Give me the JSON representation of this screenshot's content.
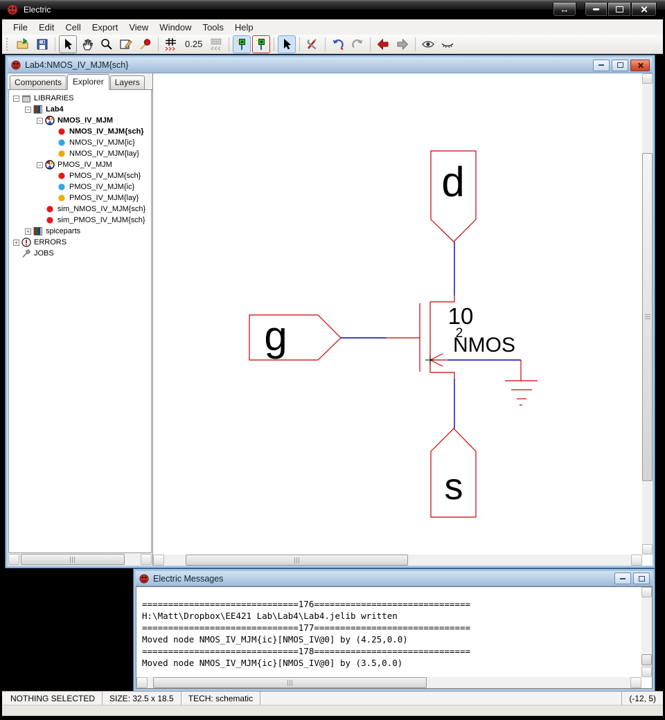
{
  "titlebar": {
    "title": "Electric"
  },
  "menubar": {
    "items": [
      "File",
      "Edit",
      "Cell",
      "Export",
      "View",
      "Window",
      "Tools",
      "Help"
    ]
  },
  "toolbar": {
    "grid_spacing": "0.25",
    "icons": [
      "open-icon",
      "save-icon",
      "|",
      "select-arrow-icon",
      "pan-hand-icon",
      "zoom-icon",
      "edit-cell-icon",
      "probe-icon",
      "|",
      "grid-coarse-icon",
      "grid-value",
      "grid-fine-icon",
      "|",
      "pin-toggle-on-icon",
      "pin-toggle-alt-icon",
      "|",
      "special-select-icon",
      "|",
      "tools-icon",
      "|",
      "undo-icon",
      "redo-icon",
      "|",
      "back-icon",
      "forward-icon",
      "|",
      "eye-open-icon",
      "eye-closed-icon"
    ]
  },
  "schematic_window": {
    "title": "Lab4:NMOS_IV_MJM{sch}",
    "tabs": [
      {
        "label": "Components",
        "active": false
      },
      {
        "label": "Explorer",
        "active": true
      },
      {
        "label": "Layers",
        "active": false
      }
    ],
    "tree": [
      {
        "label": "LIBRARIES",
        "level": 0,
        "icon": "libraries-icon",
        "expand": "minus",
        "bold": false
      },
      {
        "label": "Lab4",
        "level": 1,
        "icon": "library-icon",
        "expand": "minus",
        "bold": true
      },
      {
        "label": "NMOS_IV_MJM",
        "level": 2,
        "icon": "cell-group-icon",
        "expand": "minus",
        "bold": true
      },
      {
        "label": "NMOS_IV_MJM{sch}",
        "level": 3,
        "icon": "schematic-view-icon",
        "expand": "none",
        "bold": true
      },
      {
        "label": "NMOS_IV_MJM{ic}",
        "level": 3,
        "icon": "icon-view-icon",
        "expand": "none",
        "bold": false
      },
      {
        "label": "NMOS_IV_MJM{lay}",
        "level": 3,
        "icon": "layout-view-icon",
        "expand": "none",
        "bold": false
      },
      {
        "label": "PMOS_IV_MJM",
        "level": 2,
        "icon": "cell-group-icon",
        "expand": "minus",
        "bold": false
      },
      {
        "label": "PMOS_IV_MJM{sch}",
        "level": 3,
        "icon": "schematic-view-icon",
        "expand": "none",
        "bold": false
      },
      {
        "label": "PMOS_IV_MJM{ic}",
        "level": 3,
        "icon": "icon-view-icon",
        "expand": "none",
        "bold": false
      },
      {
        "label": "PMOS_IV_MJM{lay}",
        "level": 3,
        "icon": "layout-view-icon",
        "expand": "none",
        "bold": false
      },
      {
        "label": "sim_NMOS_IV_MJM{sch}",
        "level": 2,
        "icon": "schematic-view-icon",
        "expand": "none",
        "bold": false
      },
      {
        "label": "sim_PMOS_IV_MJM{sch}",
        "level": 2,
        "icon": "schematic-view-icon",
        "expand": "none",
        "bold": false
      },
      {
        "label": "spiceparts",
        "level": 1,
        "icon": "library-icon",
        "expand": "plus",
        "bold": false
      },
      {
        "label": "ERRORS",
        "level": 0,
        "icon": "errors-icon",
        "expand": "plus",
        "bold": false
      },
      {
        "label": "JOBS",
        "level": 0,
        "icon": "jobs-icon",
        "expand": "none",
        "bold": false
      }
    ]
  },
  "canvas": {
    "pin_labels": {
      "drain": "d",
      "gate": "g",
      "source": "s"
    },
    "transistor": {
      "width": "10",
      "length": "2",
      "model": "NMOS"
    },
    "colors": {
      "artwork": "#c80000",
      "wire": "#0000bb",
      "text": "#000000"
    }
  },
  "messages_window": {
    "title": "Electric Messages",
    "lines": [
      "==============================176==============================",
      "H:\\Matt\\Dropbox\\EE421 Lab\\Lab4\\Lab4.jelib written",
      "==============================177==============================",
      "Moved node NMOS_IV_MJM{ic}[NMOS_IV@0] by (4.25,0.0)",
      "==============================178==============================",
      "Moved node NMOS_IV_MJM{ic}[NMOS_IV@0] by (3.5,0.0)"
    ]
  },
  "statusbar": {
    "selection": "NOTHING SELECTED",
    "size": "SIZE: 32.5 x 18.5",
    "tech": "TECH: schematic",
    "coords": "(-12, 5)"
  }
}
